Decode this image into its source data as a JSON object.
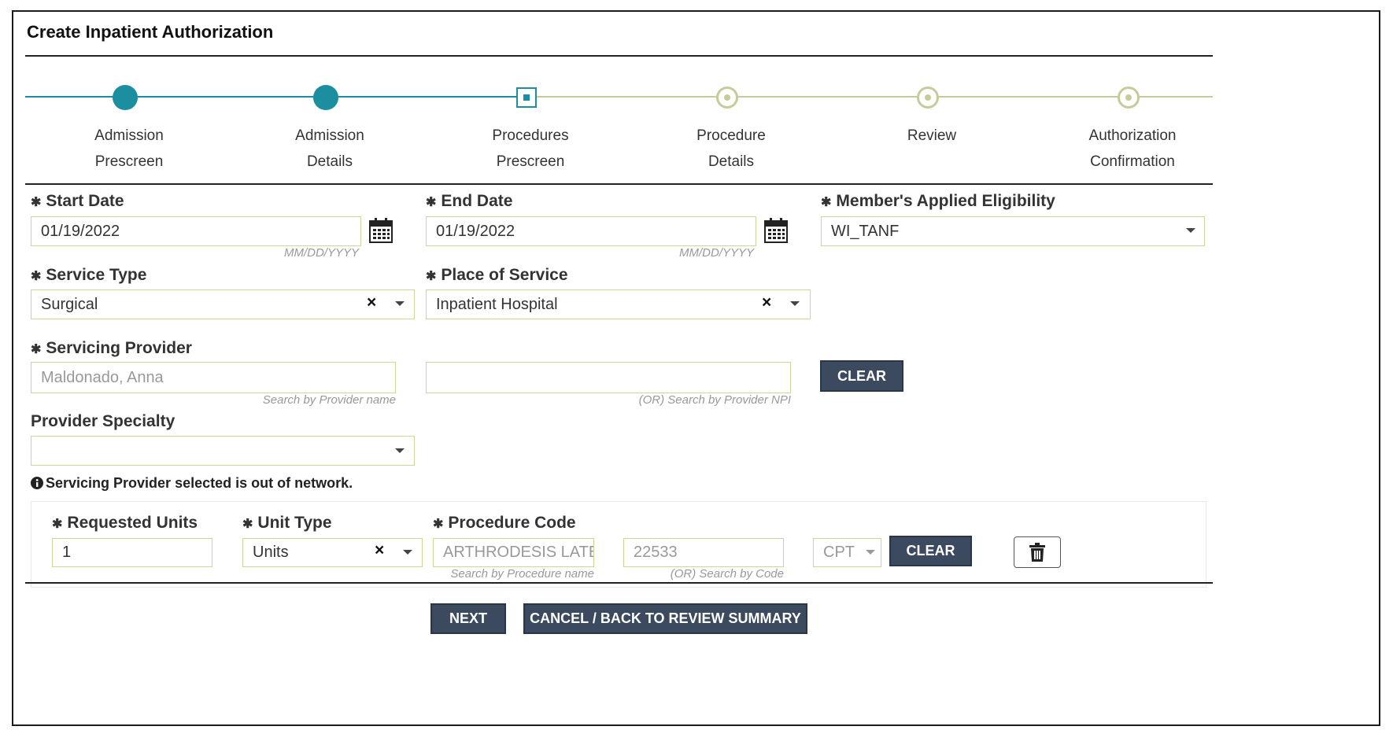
{
  "window": {
    "title": "Create Inpatient Authorization"
  },
  "colors": {
    "accent": "#1b8fa0",
    "future_step": "#c8cb99",
    "button": "#3b4a5e",
    "field_border": "#cfd49a"
  },
  "stepper": {
    "steps": [
      {
        "line1": "Admission",
        "line2": "Prescreen",
        "state": "done"
      },
      {
        "line1": "Admission",
        "line2": "Details",
        "state": "done"
      },
      {
        "line1": "Procedures",
        "line2": "Prescreen",
        "state": "current"
      },
      {
        "line1": "Procedure",
        "line2": "Details",
        "state": "future"
      },
      {
        "line1": "Review",
        "line2": "",
        "state": "future"
      },
      {
        "line1": "Authorization",
        "line2": "Confirmation",
        "state": "future"
      }
    ]
  },
  "form": {
    "required_mark": "✱",
    "start_date": {
      "label": "Start Date",
      "value": "01/19/2022",
      "hint": "MM/DD/YYYY"
    },
    "end_date": {
      "label": "End Date",
      "value": "01/19/2022",
      "hint": "MM/DD/YYYY"
    },
    "eligibility": {
      "label": "Member's Applied Eligibility",
      "value": "WI_TANF"
    },
    "service_type": {
      "label": "Service Type",
      "value": "Surgical"
    },
    "place_of_service": {
      "label": "Place of Service",
      "value": "Inpatient Hospital"
    },
    "servicing_provider": {
      "label": "Servicing Provider",
      "name_value": "Maldonado, Anna",
      "name_hint": "Search by Provider name",
      "npi_value": "",
      "npi_hint": "(OR) Search by Provider NPI",
      "clear_label": "CLEAR"
    },
    "provider_specialty": {
      "label": "Provider Specialty",
      "value": ""
    },
    "network_note": "Servicing Provider selected is out of network."
  },
  "procedure": {
    "units_label": "Requested Units",
    "units_value": "1",
    "unit_type_label": "Unit Type",
    "unit_type_value": "Units",
    "code_label": "Procedure Code",
    "code_name_value": "ARTHRODESIS LATERA",
    "code_name_hint": "Search by Procedure name",
    "code_value": "22533",
    "code_hint": "(OR) Search by Code",
    "code_system": "CPT",
    "clear_label": "CLEAR"
  },
  "footer": {
    "next_label": "NEXT",
    "cancel_label": "CANCEL / BACK TO REVIEW SUMMARY"
  }
}
